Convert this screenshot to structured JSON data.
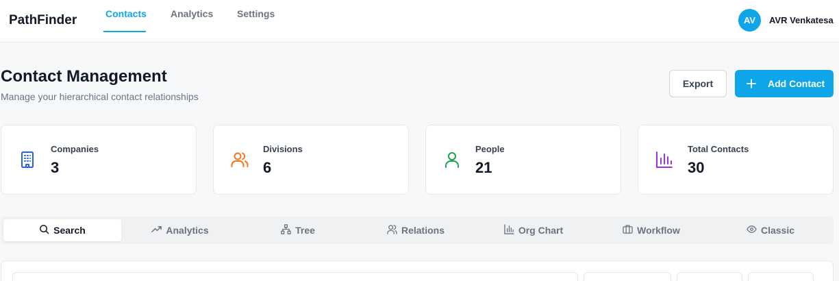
{
  "app": {
    "brand": "PathFinder"
  },
  "nav": {
    "tabs": [
      {
        "label": "Contacts"
      },
      {
        "label": "Analytics"
      },
      {
        "label": "Settings"
      }
    ],
    "active": "Contacts"
  },
  "user": {
    "initials": "AV",
    "name": "AVR Venkatesa"
  },
  "header": {
    "title": "Contact Management",
    "subtitle": "Manage your hierarchical contact relationships"
  },
  "actions": {
    "export_label": "Export",
    "add_label": "Add Contact"
  },
  "stats": [
    {
      "label": "Companies",
      "value": "3",
      "icon": "building-icon",
      "color": "#2563eb"
    },
    {
      "label": "Divisions",
      "value": "6",
      "icon": "users-icon",
      "color": "#f97316"
    },
    {
      "label": "People",
      "value": "21",
      "icon": "user-icon",
      "color": "#16a34a"
    },
    {
      "label": "Total Contacts",
      "value": "30",
      "icon": "bar-chart-icon",
      "color": "#9333ea"
    }
  ],
  "view_tabs": [
    {
      "label": "Search",
      "icon": "search-icon"
    },
    {
      "label": "Analytics",
      "icon": "trending-up-icon"
    },
    {
      "label": "Tree",
      "icon": "tree-icon"
    },
    {
      "label": "Relations",
      "icon": "users-icon"
    },
    {
      "label": "Org Chart",
      "icon": "bar-chart-icon"
    },
    {
      "label": "Workflow",
      "icon": "briefcase-icon"
    },
    {
      "label": "Classic",
      "icon": "eye-icon"
    }
  ],
  "colors": {
    "accent": "#0ea5e9"
  }
}
